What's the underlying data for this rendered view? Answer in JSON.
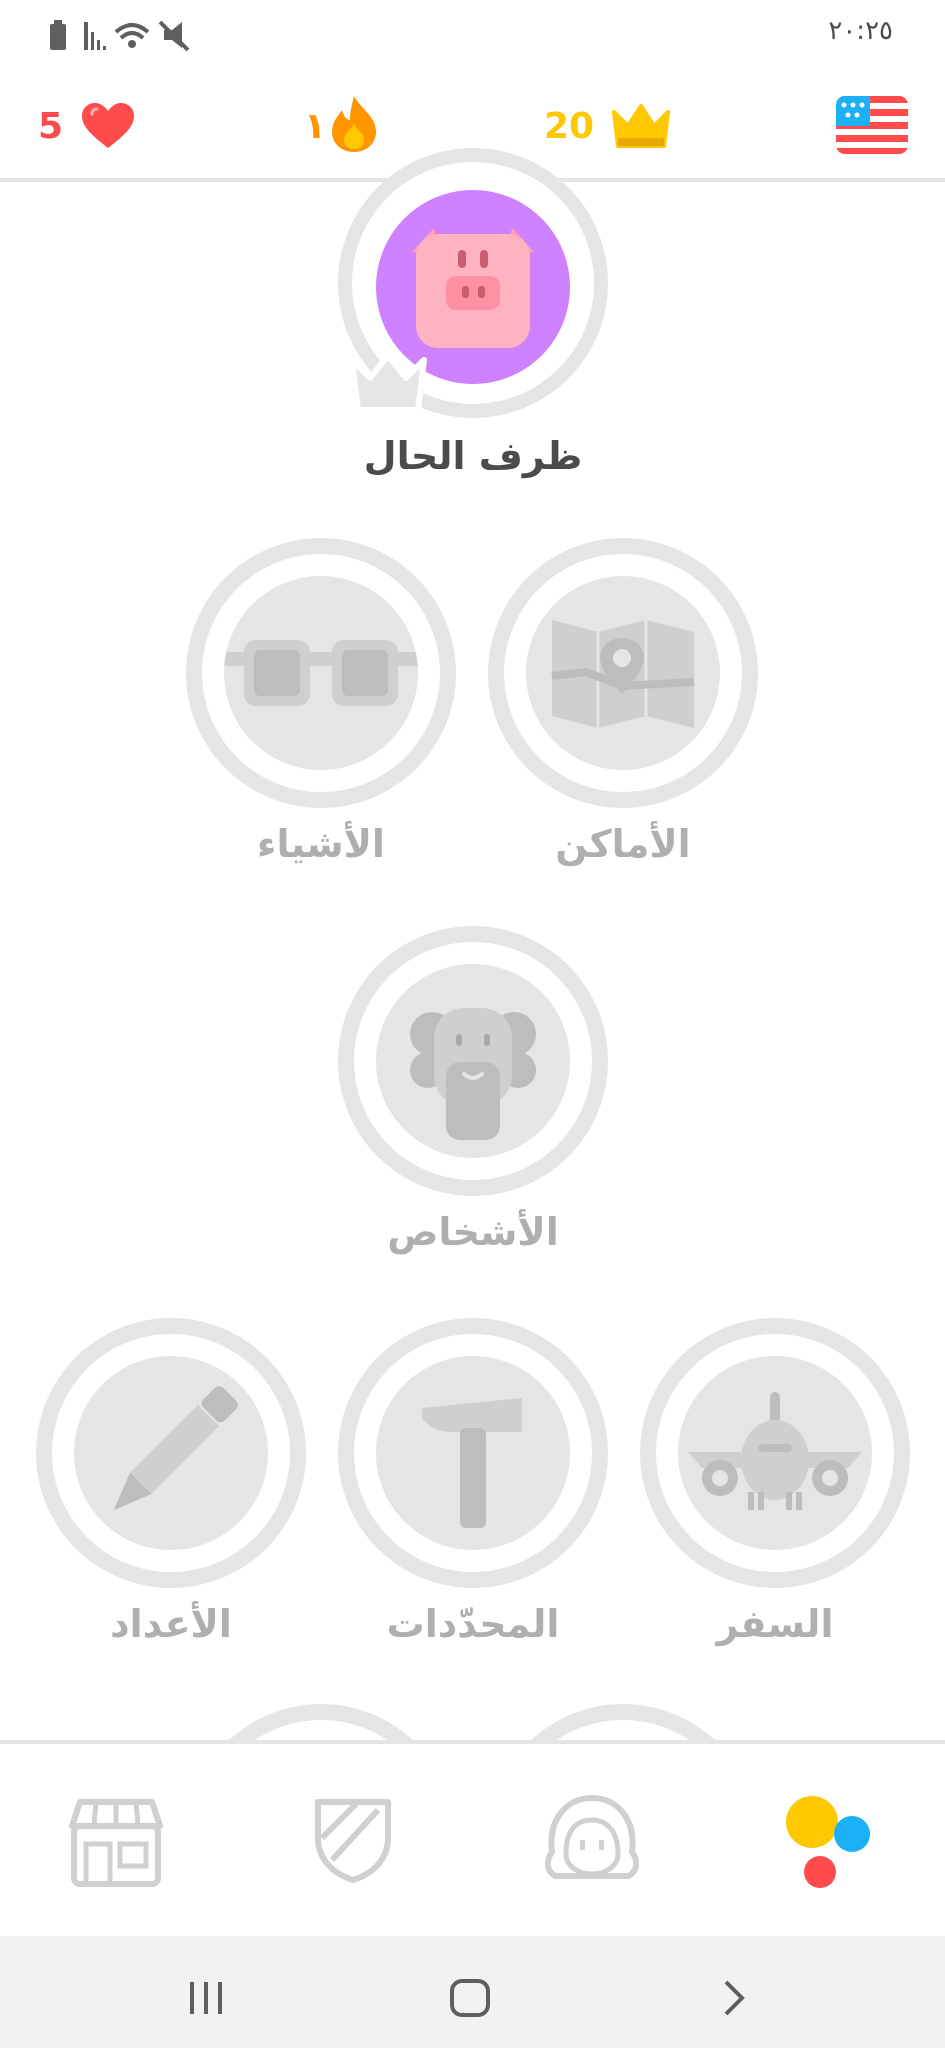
{
  "status_bar": {
    "time": "٢٠:٢٥"
  },
  "stats": {
    "hearts": "5",
    "streak": "١",
    "crowns": "20",
    "course_flag": "us-flag-icon",
    "colors": {
      "hearts": "#ff4b4b",
      "streak": "#ff9600",
      "crowns": "#ffc800"
    }
  },
  "skills": {
    "current": {
      "label": "ظرف الحال",
      "icon": "pig-icon",
      "color": "#ce82ff"
    },
    "things": {
      "label": "الأشياء",
      "icon": "glasses-icon"
    },
    "places": {
      "label": "الأماكن",
      "icon": "map-icon"
    },
    "people": {
      "label": "الأشخاص",
      "icon": "person-icon"
    },
    "numbers": {
      "label": "الأعداد",
      "icon": "pencil-icon"
    },
    "determiners": {
      "label": "المحدّدات",
      "icon": "hammer-icon"
    },
    "travel": {
      "label": "السفر",
      "icon": "airplane-icon"
    }
  },
  "bottom_nav": [
    "shop-icon",
    "shield-icon",
    "profile-icon",
    "learn-icon"
  ],
  "system_nav": [
    "recent-apps-icon",
    "home-icon",
    "back-icon"
  ]
}
